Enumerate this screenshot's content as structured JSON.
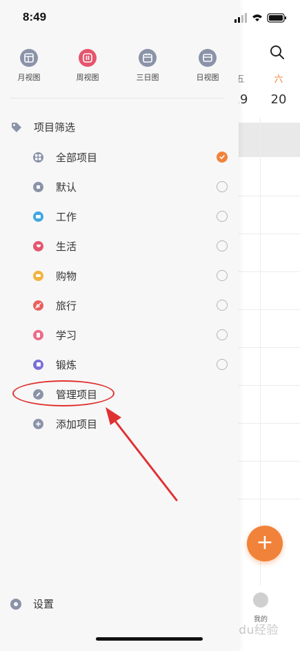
{
  "status_bar": {
    "time": "8:49"
  },
  "calendar_bg": {
    "weekdays": [
      "五",
      "六"
    ],
    "dates": [
      "19",
      "20"
    ],
    "fab_label": "+",
    "tab_mine": "我的",
    "watermark": "Baidu经验"
  },
  "drawer": {
    "views": [
      {
        "label": "月视图",
        "color": "#8a93a8",
        "icon": "month-view-icon"
      },
      {
        "label": "周视图",
        "color": "#e5566e",
        "icon": "week-view-icon"
      },
      {
        "label": "三日图",
        "color": "#8a93a8",
        "icon": "three-day-view-icon"
      },
      {
        "label": "日视图",
        "color": "#8a93a8",
        "icon": "day-view-icon"
      }
    ],
    "filter_title": "项目筛选",
    "projects": [
      {
        "label": "全部项目",
        "color": "#8a93a8",
        "checked": true
      },
      {
        "label": "默认",
        "color": "#8a93a8",
        "checked": false
      },
      {
        "label": "工作",
        "color": "#3fa8e3",
        "checked": false
      },
      {
        "label": "生活",
        "color": "#e5566e",
        "checked": false
      },
      {
        "label": "购物",
        "color": "#f2b33d",
        "checked": false
      },
      {
        "label": "旅行",
        "color": "#ea5f5f",
        "checked": false
      },
      {
        "label": "学习",
        "color": "#ee6b8a",
        "checked": false
      },
      {
        "label": "锻炼",
        "color": "#7a6fd8",
        "checked": false
      }
    ],
    "manage_label": "管理项目",
    "add_label": "添加项目",
    "settings_label": "设置"
  },
  "colors": {
    "accent": "#f0823a",
    "annotation": "#e03131"
  }
}
